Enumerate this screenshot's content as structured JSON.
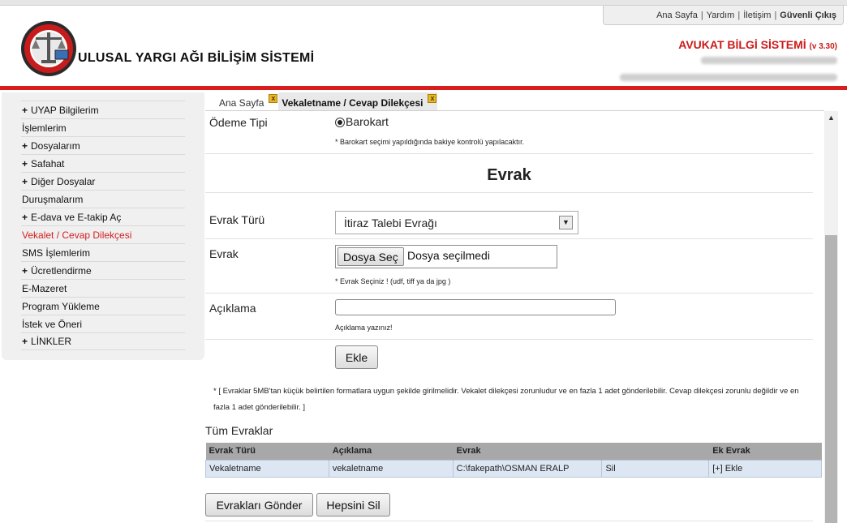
{
  "top_links": {
    "home": "Ana Sayfa",
    "help": "Yardım",
    "contact": "İletişim",
    "logout": "Güvenli Çıkış"
  },
  "header": {
    "site_title": "ULUSAL YARGI AĞI BİLİŞİM SİSTEMİ",
    "app_name": "AVUKAT BİLGİ SİSTEMİ",
    "app_version": "(v 3.30)",
    "user_line": "Sayın Av. ÖSSSS ERALP",
    "date_line": "Tarih : Perşembe | 20 Nisan 2013 | 15:11:##"
  },
  "sidebar": {
    "items": [
      {
        "label": "UYAP Bilgilerim",
        "expandable": "+"
      },
      {
        "label": "İşlemlerim",
        "expandable": ""
      },
      {
        "label": "Dosyalarım",
        "expandable": "+"
      },
      {
        "label": "Safahat",
        "expandable": "+"
      },
      {
        "label": "Diğer Dosyalar",
        "expandable": "+"
      },
      {
        "label": "Duruşmalarım",
        "expandable": ""
      },
      {
        "label": "E-dava ve E-takip Aç",
        "expandable": "+"
      },
      {
        "label": "Vekalet / Cevap Dilekçesi",
        "expandable": ""
      },
      {
        "label": "SMS İşlemlerim",
        "expandable": ""
      },
      {
        "label": "Ücretlendirme",
        "expandable": "+"
      },
      {
        "label": "E-Mazeret",
        "expandable": ""
      },
      {
        "label": "Program Yükleme",
        "expandable": ""
      },
      {
        "label": "İstek ve Öneri",
        "expandable": ""
      },
      {
        "label": "LİNKLER",
        "expandable": "+"
      }
    ]
  },
  "tabs": [
    {
      "label": "Ana Sayfa",
      "close": "x"
    },
    {
      "label": "Vekaletname / Cevap Dilekçesi",
      "close": "x"
    }
  ],
  "form": {
    "payment_label": "Ödeme Tipi",
    "payment_option": "Barokart",
    "payment_note": "* Barokart seçimi yapıldığında bakiye kontrolü yapılacaktır.",
    "section_title": "Evrak",
    "doc_type_label": "Evrak Türü",
    "doc_type_value": "İtiraz Talebi Evrağı",
    "doc_label": "Evrak",
    "file_button": "Dosya Seç",
    "file_status": "Dosya seçilmedi",
    "file_note": "* Evrak Seçiniz ! (udf, tiff ya da jpg )",
    "desc_label": "Açıklama",
    "desc_value": "",
    "desc_note": "Açıklama yazınız!",
    "add_button": "Ekle",
    "info_text": "* [ Evraklar 5MB'tan küçük belirtilen formatlara uygun şekilde girilmelidir. Vekalet dilekçesi zorunludur ve en fazla 1 adet gönderilebilir. Cevap dilekçesi zorunlu değildir ve en fazla 1 adet gönderilebilir. ]"
  },
  "documents": {
    "heading": "Tüm Evraklar",
    "columns": [
      "Evrak Türü",
      "Açıklama",
      "Evrak",
      "",
      "Ek Evrak"
    ],
    "rows": [
      [
        "Vekaletname",
        "vekaletname",
        "C:\\fakepath\\OSMAN ERALP",
        "Sil",
        "[+] Ekle"
      ]
    ],
    "send_button": "Evrakları Gönder",
    "delete_all_button": "Hepsini Sil"
  },
  "colors": {
    "brand_red": "#d81d1d",
    "active_menu": "#d41f1f",
    "table_header": "#a8a8a8",
    "table_row": "#dce7f3"
  },
  "icons": {
    "logo": "uyap-logo",
    "tab_close": "close-icon",
    "select_arrow": "chevron-down-icon",
    "scroll_up": "scroll-up-icon"
  }
}
